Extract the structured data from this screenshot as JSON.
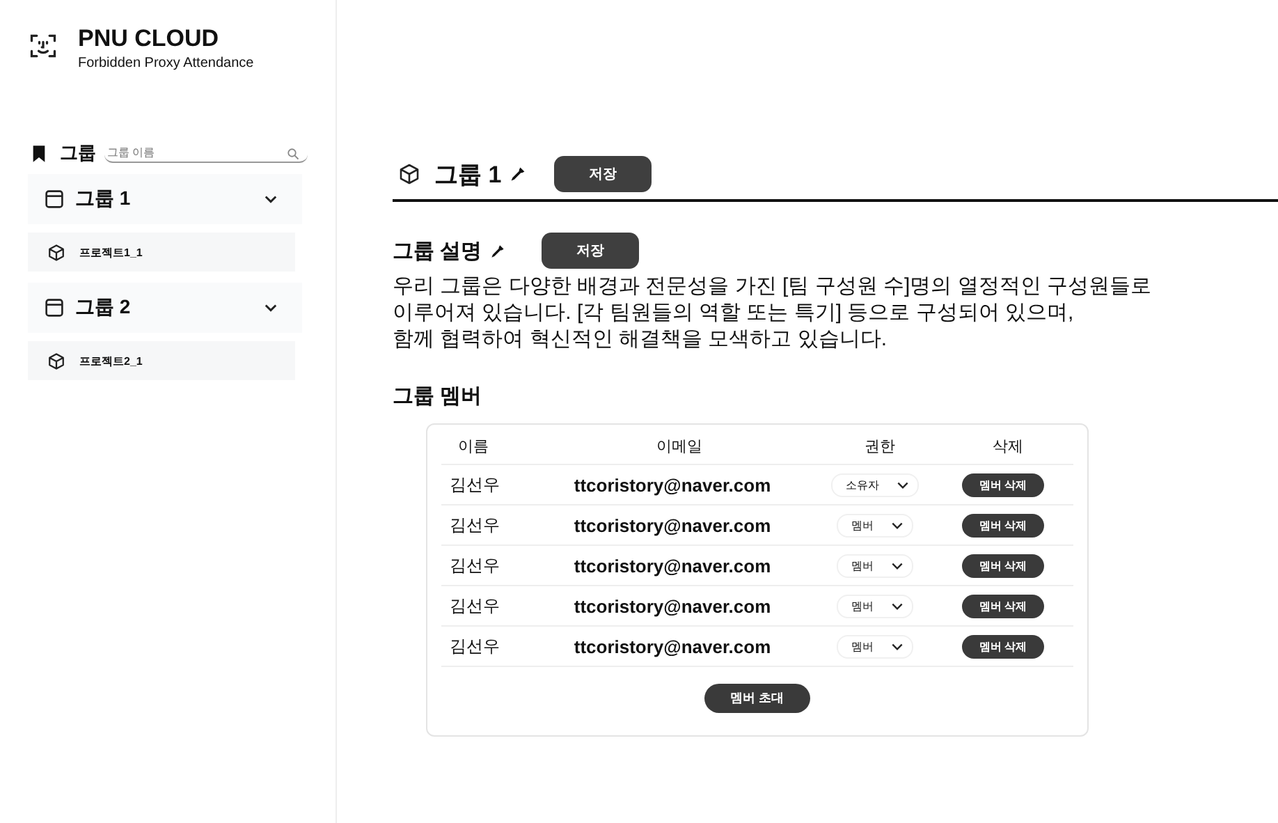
{
  "brand": {
    "title": "PNU CLOUD",
    "subtitle": "Forbidden Proxy Attendance"
  },
  "sidebar": {
    "heading": "그룹",
    "search": {
      "placeholder": "그룹 이름"
    },
    "groups": [
      {
        "name": "그룹 1",
        "expanded": true,
        "projects": [
          "프로젝트1_1"
        ]
      },
      {
        "name": "그룹 2",
        "expanded": true,
        "projects": [
          "프로젝트2_1"
        ]
      }
    ]
  },
  "group": {
    "name": "그룹 1",
    "save": "저장"
  },
  "description": {
    "heading": "그룹 설명",
    "save": "저장",
    "text": "우리 그룹은 다양한 배경과 전문성을 가진 [팀 구성원 수]명의 열정적인 구성원들로\n이루어져 있습니다. [각 팀원들의 역할 또는 특기] 등으로 구성되어 있으며,\n함께 협력하여 혁신적인 해결책을 모색하고 있습니다."
  },
  "members": {
    "heading": "그룹 멤버",
    "columns": [
      "이름",
      "이메일",
      "권한",
      "삭제"
    ],
    "rows": [
      {
        "name": "김선우",
        "email": "ttcoristory@naver.com",
        "role": "소유자",
        "delete": "멤버 삭제"
      },
      {
        "name": "김선우",
        "email": "ttcoristory@naver.com",
        "role": "멤버",
        "delete": "멤버 삭제"
      },
      {
        "name": "김선우",
        "email": "ttcoristory@naver.com",
        "role": "멤버",
        "delete": "멤버 삭제"
      },
      {
        "name": "김선우",
        "email": "ttcoristory@naver.com",
        "role": "멤버",
        "delete": "멤버 삭제"
      },
      {
        "name": "김선우",
        "email": "ttcoristory@naver.com",
        "role": "멤버",
        "delete": "멤버 삭제"
      }
    ],
    "invite": "멤버 초대"
  }
}
